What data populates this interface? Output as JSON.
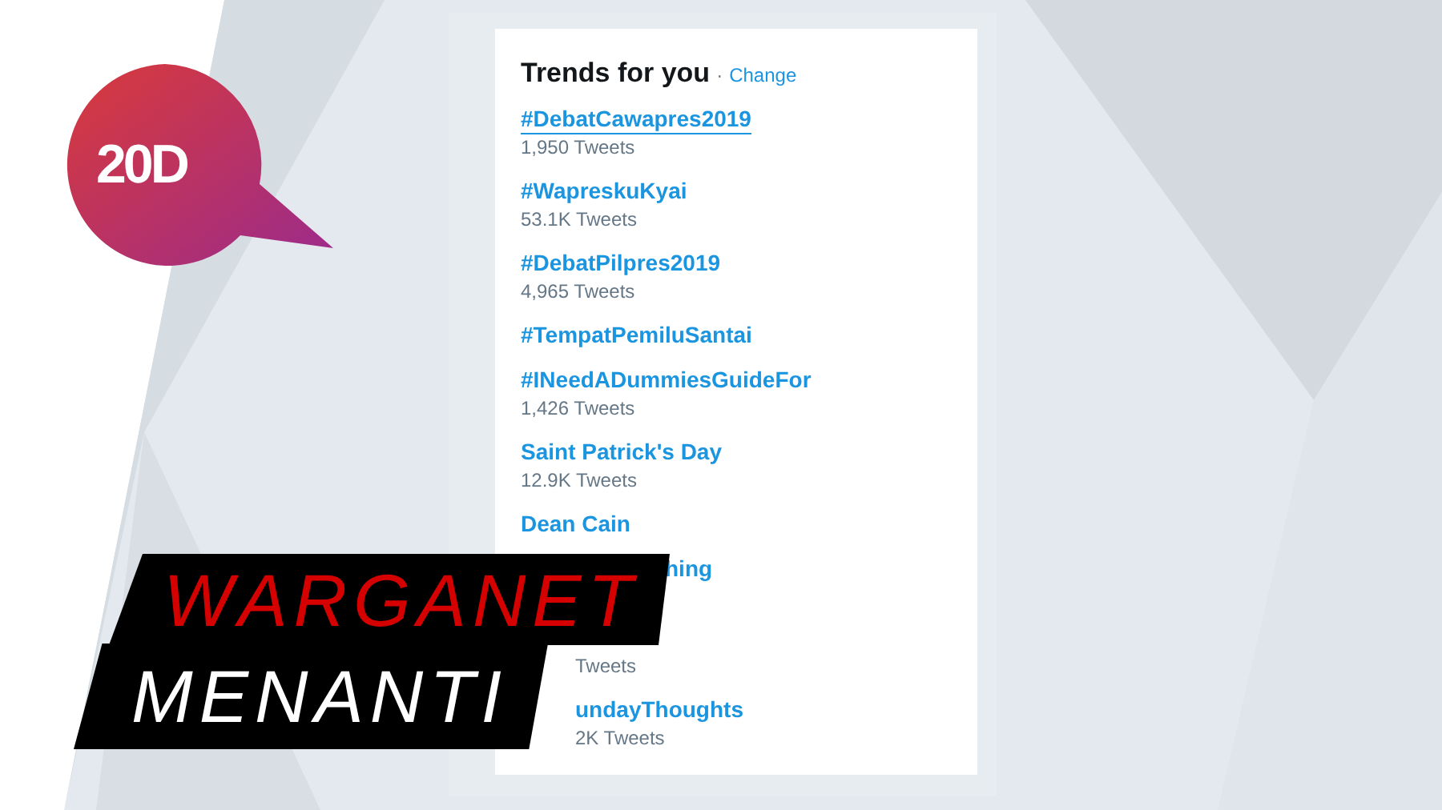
{
  "logo": {
    "text": "20D"
  },
  "panel": {
    "title": "Trends for you",
    "separator": "·",
    "action": "Change"
  },
  "trends": [
    {
      "kind": "full",
      "name": "#DebatCawapres2019",
      "count": "1,950 Tweets",
      "hovered": true
    },
    {
      "kind": "full",
      "name": "#WapreskuKyai",
      "count": "53.1K Tweets",
      "hovered": false
    },
    {
      "kind": "full",
      "name": "#DebatPilpres2019",
      "count": "4,965 Tweets",
      "hovered": false
    },
    {
      "kind": "full",
      "name": "#TempatPemiluSantai",
      "hovered": false
    },
    {
      "kind": "full",
      "name": "#INeedADummiesGuideFor",
      "count": "1,426 Tweets",
      "hovered": false
    },
    {
      "kind": "full",
      "name": "Saint Patrick's Day",
      "count": "12.9K Tweets",
      "hovered": false
    },
    {
      "kind": "full",
      "name": "Dean Cain",
      "hovered": false
    },
    {
      "kind": "cut-long",
      "name": "hing",
      "hovered": false
    },
    {
      "kind": "cut-gap",
      "count": "Tweets"
    },
    {
      "kind": "cut",
      "name": "undayThoughts",
      "count": "2K Tweets",
      "hovered": false
    }
  ],
  "banner": {
    "line_1": "WARGANET",
    "line_2": "MENANTI"
  }
}
